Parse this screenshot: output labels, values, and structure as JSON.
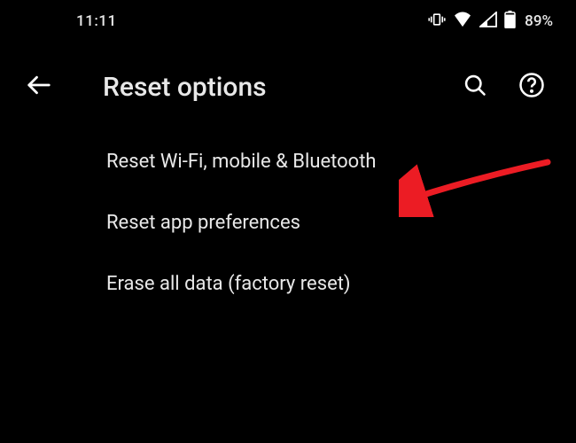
{
  "status_bar": {
    "time": "11:11",
    "battery_percent": "89%"
  },
  "header": {
    "title": "Reset options"
  },
  "options": [
    {
      "label": "Reset Wi-Fi, mobile & Bluetooth"
    },
    {
      "label": "Reset app preferences"
    },
    {
      "label": "Erase all data (factory reset)"
    }
  ]
}
